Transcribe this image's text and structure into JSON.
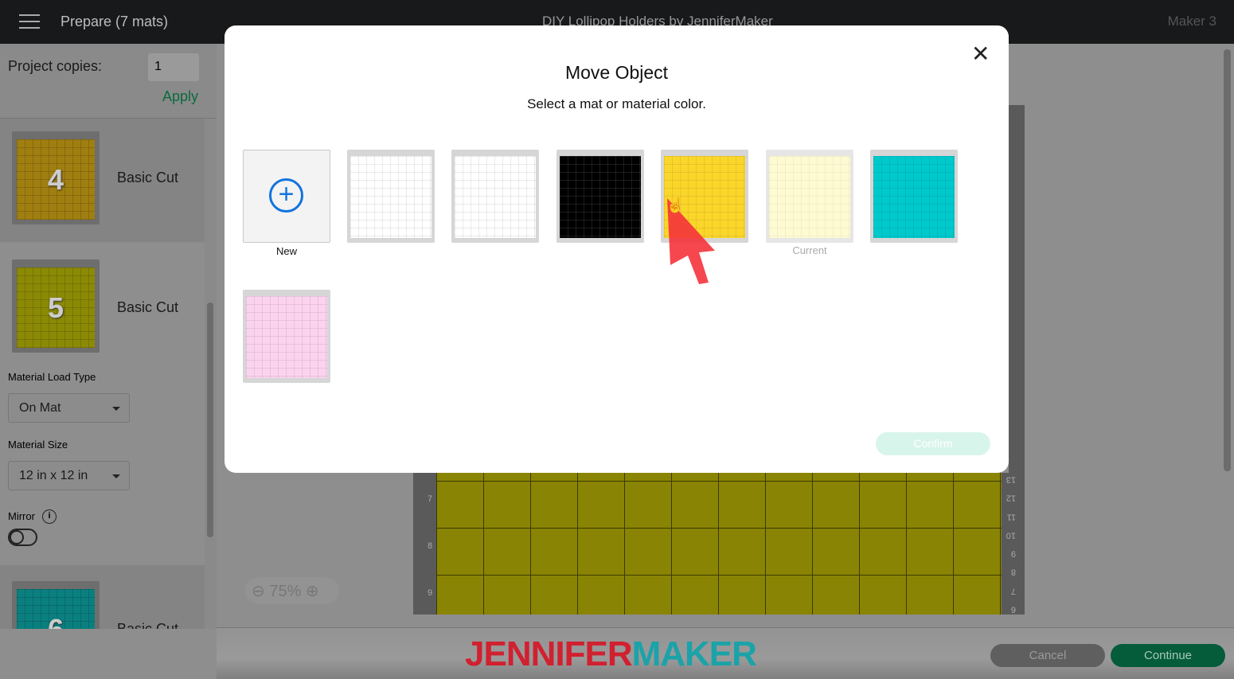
{
  "header": {
    "title": "Prepare (7 mats)",
    "project": "DIY Lollipop Holders by JenniferMaker",
    "machine": "Maker 3"
  },
  "sidebar": {
    "copies_label": "Project copies:",
    "copies_value": "1",
    "apply": "Apply",
    "mats": [
      {
        "number": "4",
        "label": "Basic Cut",
        "color": "#a07e10"
      },
      {
        "number": "5",
        "label": "Basic Cut",
        "color": "#8c8a05"
      },
      {
        "number": "6",
        "label": "Basic Cut",
        "color": "#0a7f7f"
      }
    ],
    "load_type_label": "Material Load Type",
    "load_type_value": "On Mat",
    "size_label": "Material Size",
    "size_value": "12 in x 12 in",
    "mirror_label": "Mirror",
    "mirror_on": false
  },
  "canvas": {
    "zoom": "75%",
    "ruler_left": [
      "7",
      "8",
      "9"
    ],
    "ruler_right": [
      "13",
      "12",
      "11",
      "10",
      "9",
      "8",
      "7",
      "6"
    ]
  },
  "modal": {
    "title": "Move Object",
    "subtitle": "Select a mat or material color.",
    "new_label": "New",
    "current_label": "Current",
    "confirm": "Confirm",
    "mats": [
      {
        "color": "#ffffff"
      },
      {
        "color": "#ffffff"
      },
      {
        "color": "#000000"
      },
      {
        "color": "#fbd62a"
      },
      {
        "color": "#fefbd0",
        "current": true
      },
      {
        "color": "#00c9cc"
      },
      {
        "color": "#fbd3ee"
      }
    ]
  },
  "footer": {
    "cancel": "Cancel",
    "continue": "Continue",
    "logo": "JENNIFERMAKER"
  }
}
